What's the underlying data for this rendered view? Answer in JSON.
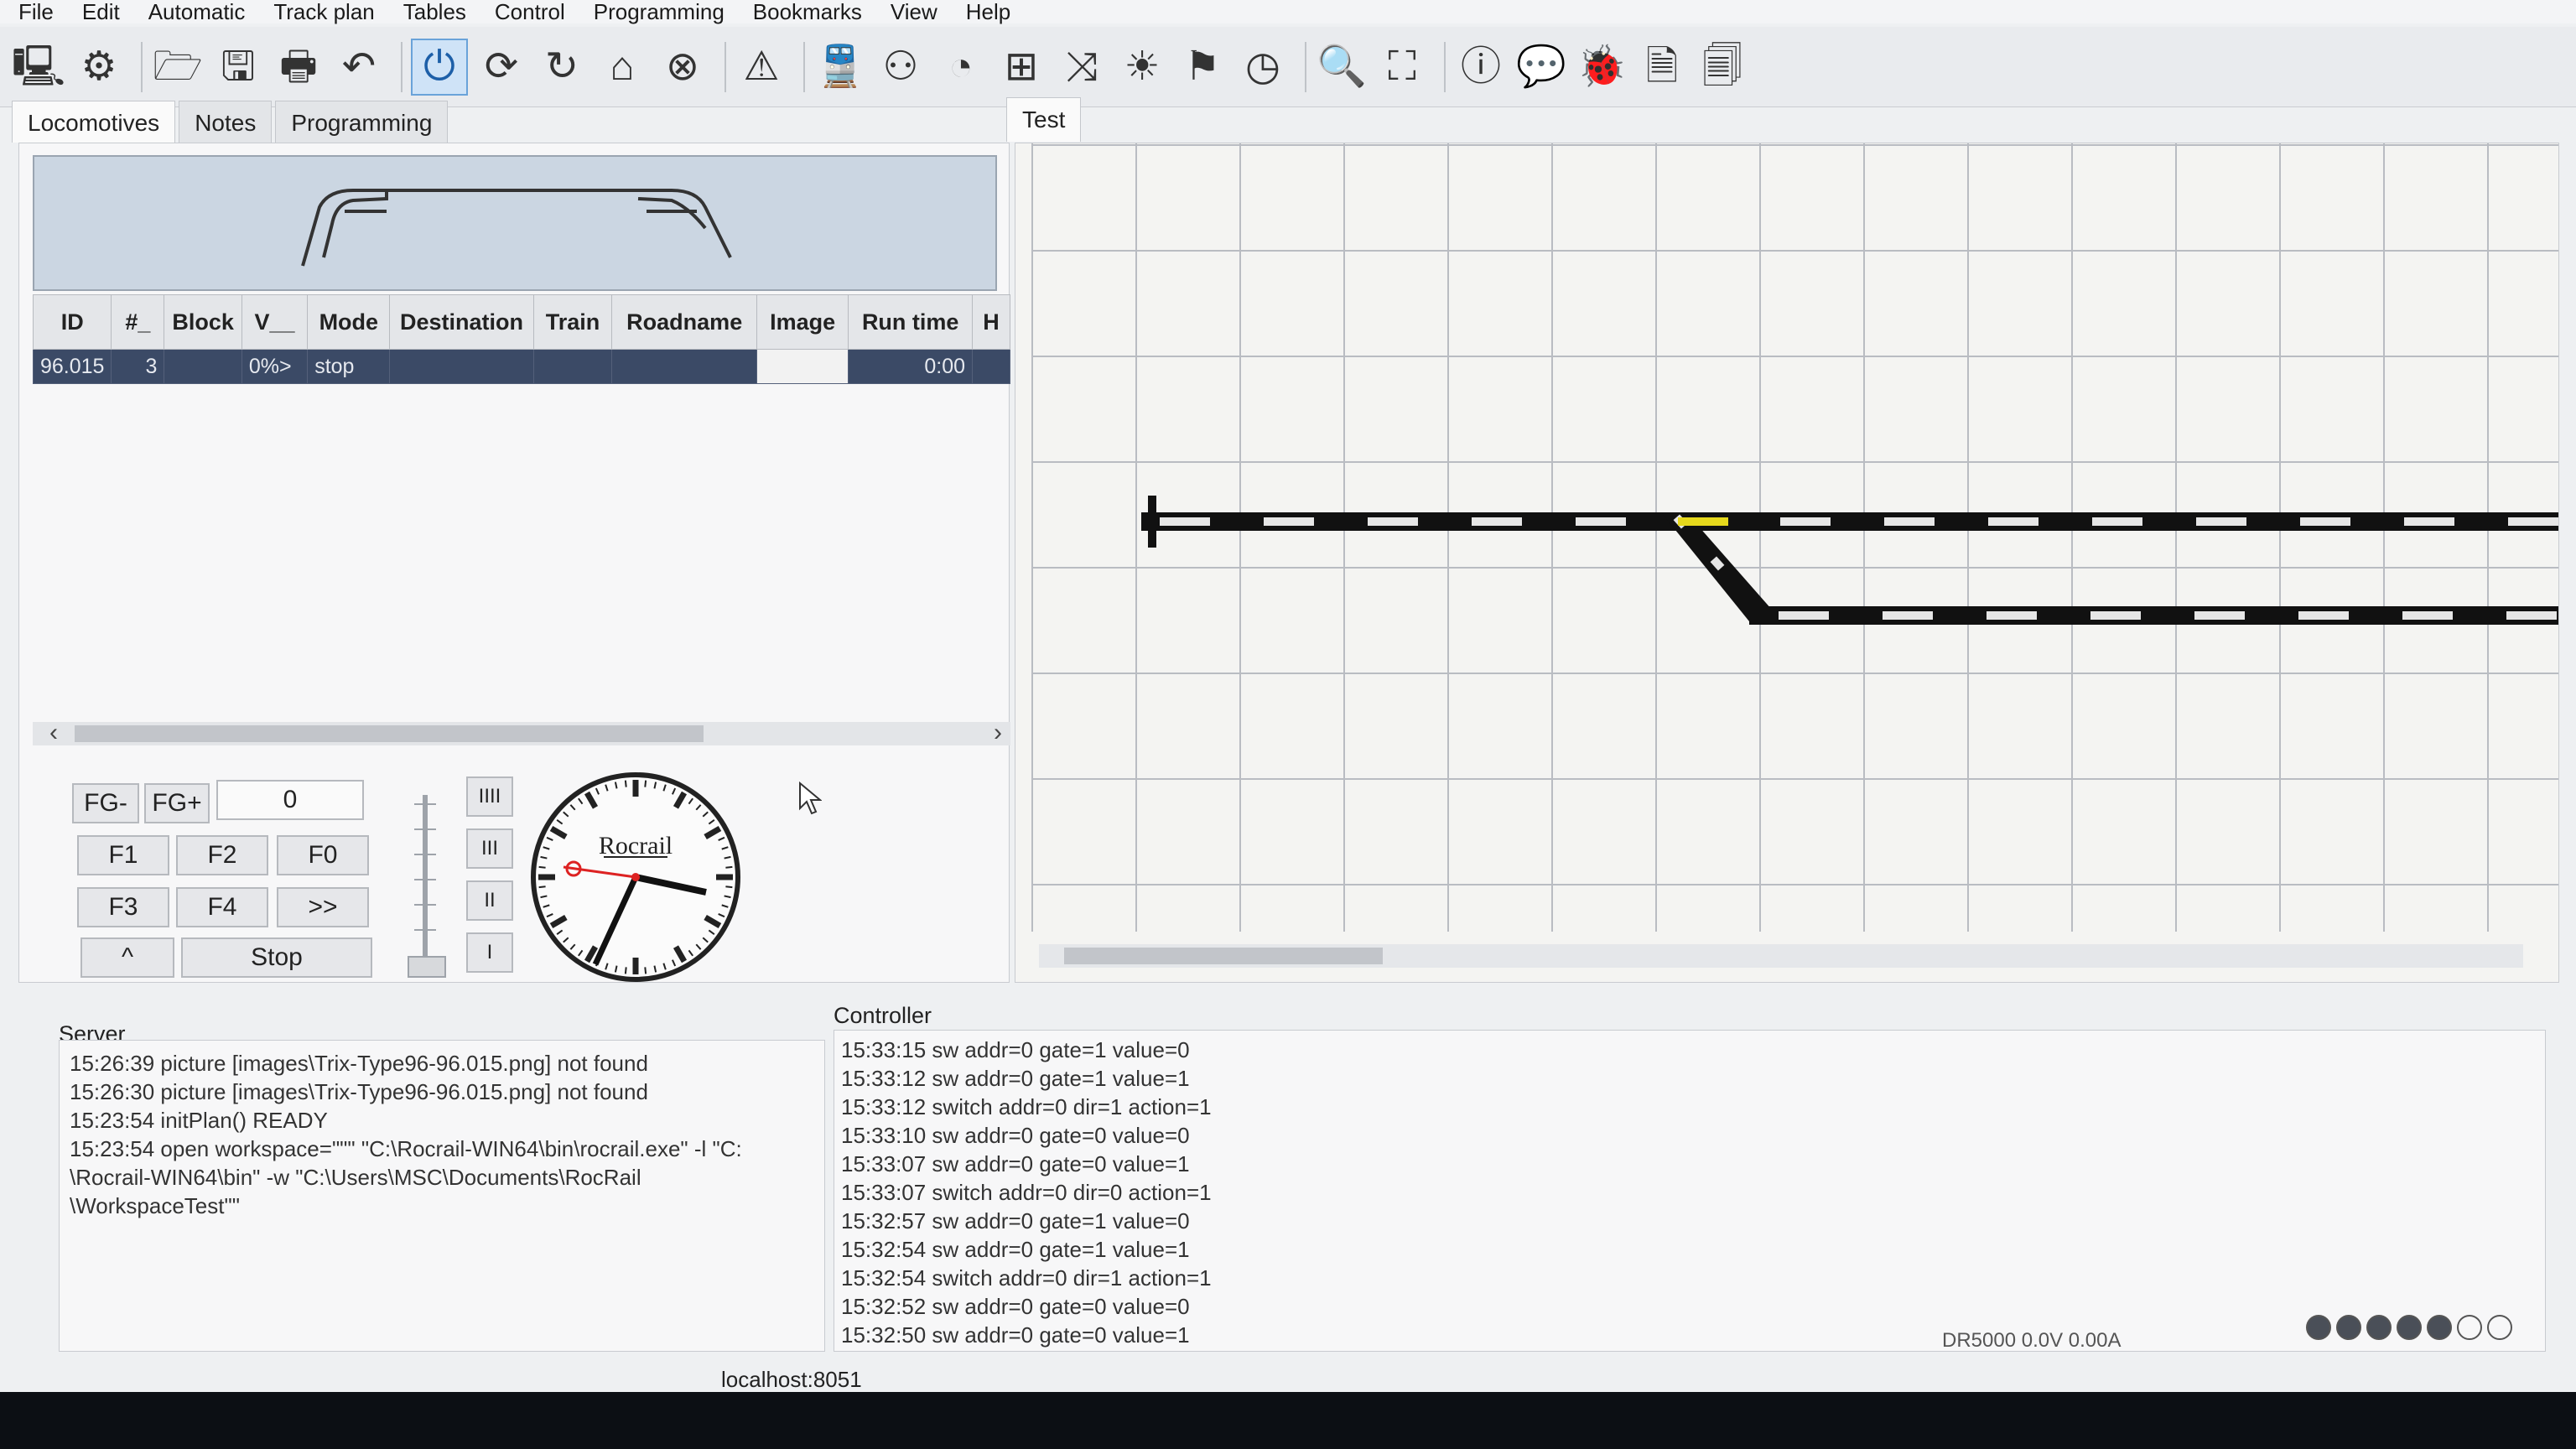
{
  "menu": [
    "File",
    "Edit",
    "Automatic",
    "Track plan",
    "Tables",
    "Control",
    "Programming",
    "Bookmarks",
    "View",
    "Help"
  ],
  "toolbar_icons": [
    {
      "name": "monitor-icon",
      "glyph": "🖳"
    },
    {
      "name": "gears-icon",
      "glyph": "⚙"
    },
    {
      "name": "open-folder-icon",
      "glyph": "🗁"
    },
    {
      "name": "save-icon",
      "glyph": "🖫"
    },
    {
      "name": "print-icon",
      "glyph": "🖶"
    },
    {
      "name": "undo-icon",
      "glyph": "↶"
    },
    {
      "name": "power-icon",
      "glyph": "⏻",
      "active": true
    },
    {
      "name": "sync-icon",
      "glyph": "⟳"
    },
    {
      "name": "reset-icon",
      "glyph": "↻"
    },
    {
      "name": "home-icon",
      "glyph": "⌂"
    },
    {
      "name": "stop-circle-icon",
      "glyph": "⊗"
    },
    {
      "name": "warning-icon",
      "glyph": "⚠"
    },
    {
      "name": "train-icon",
      "glyph": "🚆"
    },
    {
      "name": "locos-icon",
      "glyph": "⚇"
    },
    {
      "name": "throttle-icon",
      "glyph": "◔"
    },
    {
      "name": "grid-icon",
      "glyph": "⊞"
    },
    {
      "name": "shuffle-icon",
      "glyph": "⤨"
    },
    {
      "name": "sun-icon",
      "glyph": "☀"
    },
    {
      "name": "flag-icon",
      "glyph": "⚑"
    },
    {
      "name": "clock-icon",
      "glyph": "◷"
    },
    {
      "name": "zoom-icon",
      "glyph": "🔍"
    },
    {
      "name": "fullscreen-icon",
      "glyph": "⛶"
    },
    {
      "name": "info-icon",
      "glyph": "ⓘ"
    },
    {
      "name": "chat-icon",
      "glyph": "💬"
    },
    {
      "name": "bug-icon",
      "glyph": "🐞"
    },
    {
      "name": "document-icon",
      "glyph": "🗎"
    },
    {
      "name": "copy-icon",
      "glyph": "🗐"
    }
  ],
  "left_tabs": [
    "Locomotives",
    "Notes",
    "Programming"
  ],
  "table": {
    "headers": [
      "ID",
      "#_",
      "Block",
      "V__",
      "Mode",
      "Destination",
      "Train",
      "Roadname",
      "Image",
      "Run time",
      "H"
    ],
    "rows": [
      [
        "96.015",
        "3",
        "",
        "0%>",
        "stop",
        "",
        "",
        "",
        "",
        "0:00",
        ""
      ]
    ]
  },
  "controls": {
    "fg_minus": "FG-",
    "fg_plus": "FG+",
    "fg_value": "0",
    "f1": "F1",
    "f2": "F2",
    "f0": "F0",
    "f3": "F3",
    "f4": "F4",
    "more": ">>",
    "up": "^",
    "stop": "Stop",
    "steps": [
      "IIII",
      "III",
      "II",
      "I"
    ]
  },
  "clock": {
    "brand": "Rocrail"
  },
  "plan": {
    "tab": "Test"
  },
  "server": {
    "title": "Server",
    "lines": [
      "15:26:39 picture [images\\Trix-Type96-96.015.png] not found",
      "15:26:30 picture [images\\Trix-Type96-96.015.png] not found",
      "15:23:54 initPlan() READY",
      "15:23:54 open workspace=\"\"\" \"C:\\Rocrail-WIN64\\bin\\rocrail.exe\" -l \"C:",
      "\\Rocrail-WIN64\\bin\" -w \"C:\\Users\\MSC\\Documents\\RocRail",
      "\\WorkspaceTest\"\""
    ]
  },
  "controller": {
    "title": "Controller",
    "lines": [
      "15:33:15 sw addr=0 gate=1 value=0",
      "15:33:12 sw addr=0 gate=1 value=1",
      "15:33:12 switch addr=0 dir=1 action=1",
      "15:33:10 sw addr=0 gate=0 value=0",
      "15:33:07 sw addr=0 gate=0 value=1",
      "15:33:07 switch addr=0 dir=0 action=1",
      "15:32:57 sw addr=0 gate=1 value=0",
      "15:32:54 sw addr=0 gate=1 value=1",
      "15:32:54 switch addr=0 dir=1 action=1",
      "15:32:52 sw addr=0 gate=0 value=0",
      "15:32:50 sw addr=0 gate=0 value=1"
    ]
  },
  "status": {
    "host": "localhost:8051",
    "power": "DR5000 0.0V 0.00A"
  },
  "colors": {
    "track": "#111111",
    "occupied": "#e6d81c",
    "selected_row": "#3b4a66"
  }
}
